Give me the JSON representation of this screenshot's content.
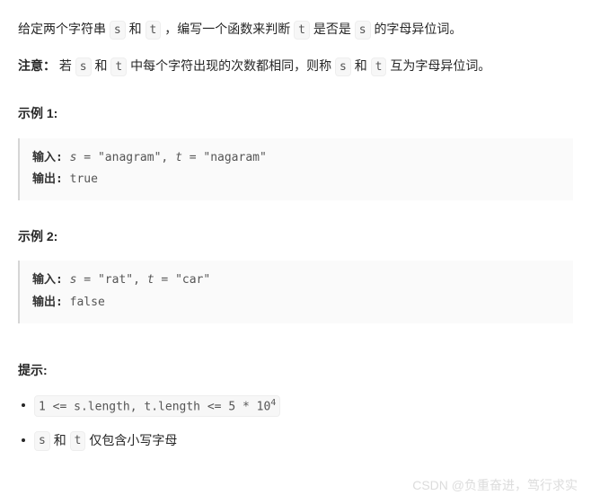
{
  "problem": {
    "desc_parts": {
      "p1": "给定两个字符串 ",
      "var_s": "s",
      "p2": " 和 ",
      "var_t": "t",
      "p3": " ，编写一个函数来判断 ",
      "p4": " 是否是 ",
      "p5": " 的字母异位词。"
    },
    "note_label": "注意：",
    "note_parts": {
      "p1": "若 ",
      "p2": " 和 ",
      "p3": " 中每个字符出现的次数都相同，则称 ",
      "p4": " 和 ",
      "p5": " 互为字母异位词。"
    }
  },
  "examples": {
    "h1": "示例 1:",
    "h2": "示例 2:",
    "input_label": "输入: ",
    "output_label": "输出: ",
    "ex1": {
      "input_s_var": "s",
      "input_s_val": " = \"anagram\", ",
      "input_t_var": "t",
      "input_t_val": " = \"nagaram\"",
      "output": "true"
    },
    "ex2": {
      "input_s_var": "s",
      "input_s_val": " = \"rat\", ",
      "input_t_var": "t",
      "input_t_val": " = \"car\"",
      "output": "false"
    }
  },
  "hints": {
    "heading": "提示:",
    "c1_pre": "1 <= s.length, t.length <= 5 * 10",
    "c1_sup": "4",
    "c2_var_s": "s",
    "c2_mid": " 和 ",
    "c2_var_t": "t",
    "c2_tail": " 仅包含小写字母"
  },
  "watermark": "CSDN @负重奋进，笃行求实"
}
